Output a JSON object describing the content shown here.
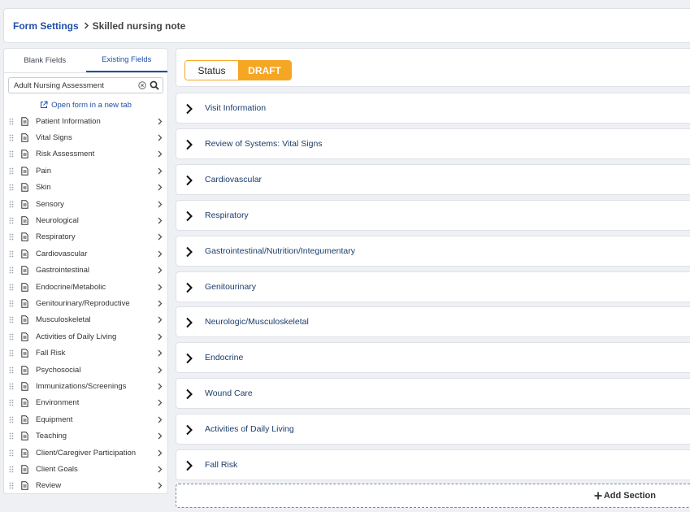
{
  "breadcrumb": {
    "link": "Form Settings",
    "current": "Skilled nursing note"
  },
  "left_panel": {
    "tabs": [
      {
        "label": "Blank Fields",
        "active": false
      },
      {
        "label": "Existing Fields",
        "active": true
      }
    ],
    "search": {
      "value": "Adult Nursing Assessment"
    },
    "open_form_link": "Open form in a new tab",
    "items": [
      {
        "label": "Patient Information"
      },
      {
        "label": "Vital Signs"
      },
      {
        "label": "Risk Assessment"
      },
      {
        "label": "Pain"
      },
      {
        "label": "Skin"
      },
      {
        "label": "Sensory"
      },
      {
        "label": "Neurological"
      },
      {
        "label": "Respiratory"
      },
      {
        "label": "Cardiovascular"
      },
      {
        "label": "Gastrointestinal"
      },
      {
        "label": "Endocrine/Metabolic"
      },
      {
        "label": "Genitourinary/Reproductive"
      },
      {
        "label": "Musculoskeletal"
      },
      {
        "label": "Activities of Daily Living"
      },
      {
        "label": "Fall Risk"
      },
      {
        "label": "Psychosocial"
      },
      {
        "label": "Immunizations/Screenings"
      },
      {
        "label": "Environment"
      },
      {
        "label": "Equipment"
      },
      {
        "label": "Teaching"
      },
      {
        "label": "Client/Caregiver Participation"
      },
      {
        "label": "Client Goals"
      },
      {
        "label": "Review"
      }
    ]
  },
  "status": {
    "label": "Status",
    "value": "DRAFT",
    "color": "#f5a623"
  },
  "sections": [
    {
      "title": "Visit Information"
    },
    {
      "title": "Review of Systems: Vital Signs"
    },
    {
      "title": "Cardiovascular"
    },
    {
      "title": "Respiratory"
    },
    {
      "title": "Gastrointestinal/Nutrition/Integumentary"
    },
    {
      "title": "Genitourinary"
    },
    {
      "title": "Neurologic/Musculoskeletal"
    },
    {
      "title": "Endocrine"
    },
    {
      "title": "Wound Care"
    },
    {
      "title": "Activities of Daily Living"
    },
    {
      "title": "Fall Risk"
    }
  ],
  "add_section_label": "Add Section",
  "colors": {
    "accent": "#1f4fa8",
    "section_title": "#1a3d6b",
    "draft": "#f5a623"
  }
}
